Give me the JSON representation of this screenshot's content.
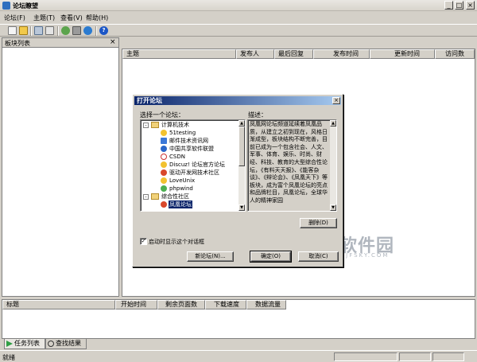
{
  "window": {
    "title": "论坛瞭望"
  },
  "menu": [
    "论坛(F)",
    "主题(T)",
    "查看(V)",
    "帮助(H)"
  ],
  "toolbar_icons": [
    "new-icon",
    "open-icon",
    "connect-icon",
    "export-icon",
    "back-icon",
    "settings-icon",
    "forward-icon",
    "help-icon"
  ],
  "left_panel": {
    "title": "板块列表",
    "close": "×"
  },
  "topic_list": {
    "columns": [
      "主题",
      "发布人",
      "最后回复",
      "发布时间",
      "更新时间",
      "访问数"
    ]
  },
  "download_list": {
    "columns": [
      "标题",
      "开始时间",
      "剩余页面数",
      "下载速度",
      "数据流量"
    ]
  },
  "tabs": [
    "任务列表",
    "查找结果"
  ],
  "status": {
    "text": "就绪"
  },
  "dialog": {
    "title": "打开论坛",
    "select_label": "选择一个论坛：",
    "desc_label": "描述：",
    "tree": {
      "group1": "计算机技术",
      "items1": [
        "51testing",
        "邮件技术资讯网",
        "中国共享软件联盟",
        "CSDN",
        "Discuz! 论坛官方论坛",
        "驱动开发网技术社区",
        "LoveUnix",
        "phpwind"
      ],
      "group2": "综合性社区",
      "items2": [
        "凤凰论坛"
      ]
    },
    "description": "凤凰网论坛频道延续着凤凰品质，从建立之初到现在，风格日渐成型，板块结构不断完善，目前已成为一个包含社会、人文、军事、体育、娱乐、时尚、财经、科技、教育的大型综合性论坛，《有料天天报》、《能客杂谈》、《辩论会》、《凤凰天下》等板块，成为富个凤凰论坛的亮点和品牌栏目，凤凰论坛，全球华人的精神家园",
    "delete_button": "删除(D)",
    "checkbox_label": "启动时显示这个对话框",
    "checkbox_checked": true,
    "new_button": "新论坛(N)...",
    "ok_button": "确定(O)",
    "cancel_button": "取消(C)"
  },
  "watermark": {
    "text": "刷风软件园",
    "url": "WWW.JFSKY.COM"
  },
  "colors": {
    "dialog_title_start": "#0a246a",
    "dialog_title_end": "#a6caf0",
    "selection": "#0a246a",
    "face": "#d4d0c8"
  }
}
